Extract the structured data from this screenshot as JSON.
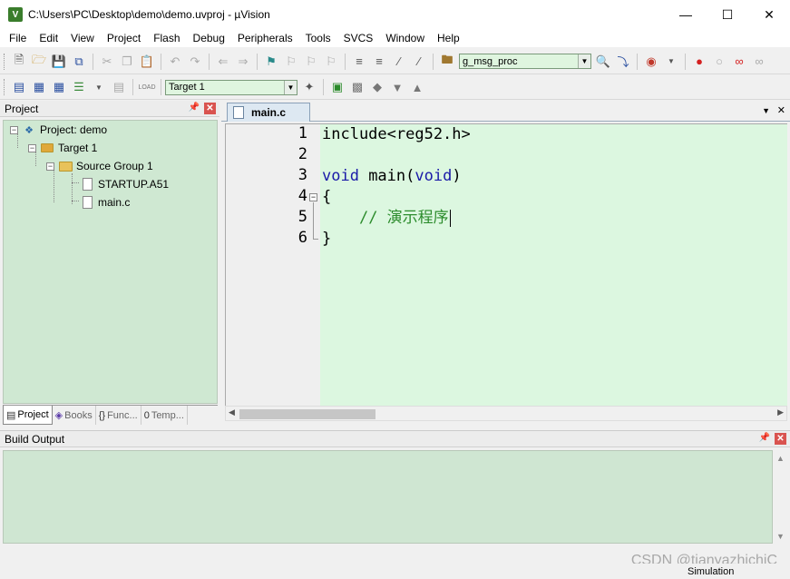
{
  "window": {
    "title": "C:\\Users\\PC\\Desktop\\demo\\demo.uvproj - µVision",
    "icon_letter": "V",
    "controls": [
      "minimize-icon",
      "maximize-icon",
      "close-icon"
    ]
  },
  "menu": [
    "File",
    "Edit",
    "View",
    "Project",
    "Flash",
    "Debug",
    "Peripherals",
    "Tools",
    "SVCS",
    "Window",
    "Help"
  ],
  "toolbar": {
    "find_combo_value": "g_msg_proc",
    "target_combo_value": "Target 1",
    "load_label": "LOAD"
  },
  "project_panel": {
    "title": "Project",
    "tree": {
      "root": "Project: demo",
      "target": "Target 1",
      "group": "Source Group 1",
      "files": [
        "STARTUP.A51",
        "main.c"
      ]
    },
    "tabs": [
      {
        "icon": "▤",
        "label": "Project"
      },
      {
        "icon": "◈",
        "label": "Books"
      },
      {
        "icon": "{}",
        "label": "Func..."
      },
      {
        "icon": "0",
        "label": "Temp..."
      }
    ]
  },
  "editor": {
    "active_tab": "main.c",
    "line_numbers": [
      "1",
      "2",
      "3",
      "4",
      "5",
      "6"
    ],
    "code": {
      "line1": "include<reg52.h>",
      "line3_kw1": "void",
      "line3_mid": " main(",
      "line3_kw2": "void",
      "line3_end": ")",
      "line4": "{",
      "line5_comment": "// 演示程序",
      "line6": "}"
    }
  },
  "build_output": {
    "title": "Build Output"
  },
  "status": {
    "mode": "Simulation"
  },
  "watermark": "CSDN @tianyazhichiC",
  "colors": {
    "code_bg": "#dcf7e0",
    "panel_bg": "#cfe8d2",
    "keyword": "#1a1aa8",
    "comment": "#2c8c2c"
  }
}
